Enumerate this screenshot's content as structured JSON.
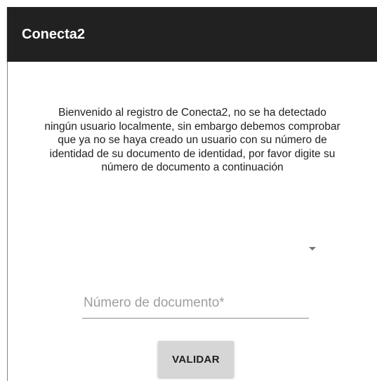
{
  "app_bar": {
    "title": "Conecta2",
    "background": "#212121"
  },
  "intro": {
    "text": "Bienvenido al registro de Conecta2, no se ha detectado ningún usuario localmente, sin embargo debemos comprobar que ya no se haya creado un usuario con su número de identidad de su documento de identidad, por favor digite su número de documento a continuación"
  },
  "spinner": {
    "selected": "",
    "icon": "chevron-down-icon"
  },
  "document_field": {
    "value": "",
    "placeholder": "Número de documento*"
  },
  "validate_button": {
    "label": "VALIDAR"
  },
  "colors": {
    "accent_edge": "#4f8fd6",
    "button_bg": "#d6d6d6"
  }
}
